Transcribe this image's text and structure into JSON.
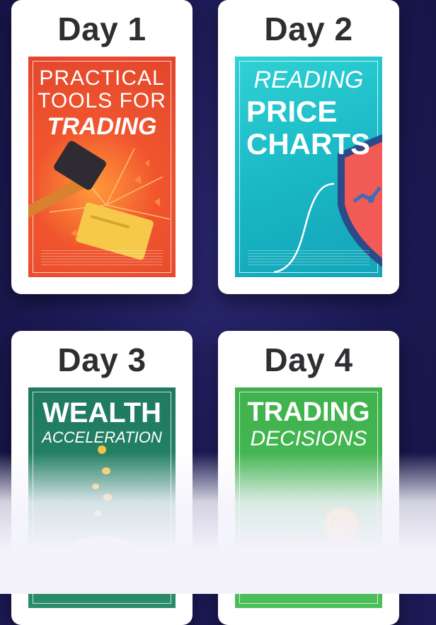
{
  "cards": [
    {
      "day": "Day 1",
      "cover": {
        "line1": "PRACTICAL",
        "line2": "TOOLS FOR",
        "line3": "TRADING"
      },
      "colors": {
        "accent": "#f0552e"
      }
    },
    {
      "day": "Day 2",
      "cover": {
        "line1": "READING",
        "line2": "PRICE",
        "line3": "CHARTS"
      },
      "colors": {
        "accent": "#19b6c5"
      }
    },
    {
      "day": "Day 3",
      "cover": {
        "line1": "WEALTH",
        "line2": "ACCELERATION"
      },
      "colors": {
        "accent": "#1f7a5f"
      }
    },
    {
      "day": "Day 4",
      "cover": {
        "line1": "TRADING",
        "line2": "DECISIONS"
      },
      "colors": {
        "accent": "#3fb24e"
      }
    }
  ]
}
